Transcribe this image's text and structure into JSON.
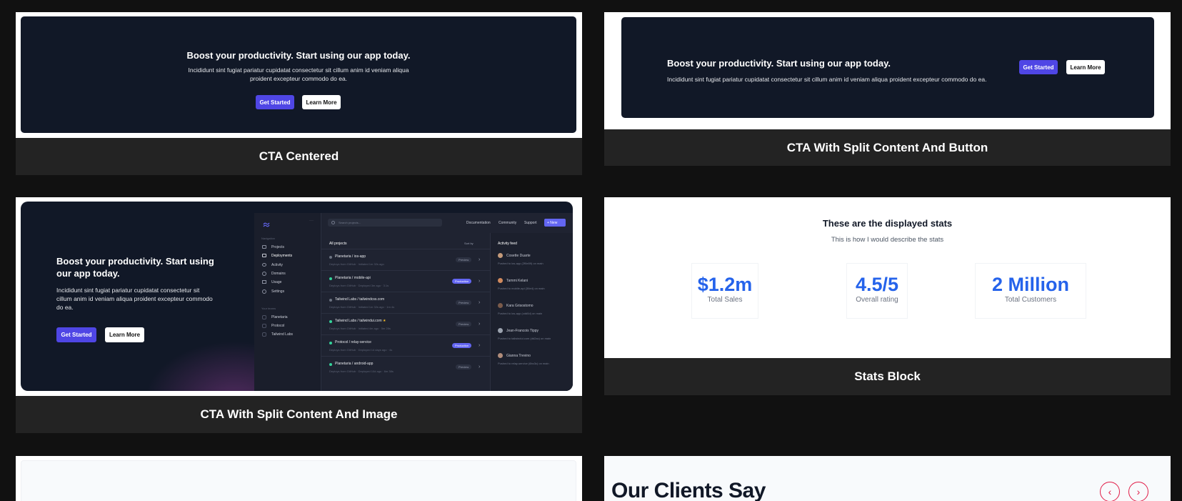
{
  "cta_centered": {
    "title": "Boost your productivity. Start using our app today.",
    "body_line1": "Incididunt sint fugiat pariatur cupidatat consectetur sit cillum anim id veniam aliqua",
    "body_line2": "proident excepteur commodo do ea.",
    "primary": "Get Started",
    "secondary": "Learn More",
    "label": "CTA Centered"
  },
  "cta_split_button": {
    "title": "Boost your productivity. Start using our app today.",
    "body": "Incididunt sint fugiat pariatur cupidatat consectetur sit cillum anim id veniam aliqua proident excepteur commodo do ea.",
    "primary": "Get Started",
    "secondary": "Learn More",
    "label": "CTA With Split Content And Button"
  },
  "cta_split_image": {
    "title_line1": "Boost your productivity. Start using",
    "title_line2": "our app today.",
    "body_line1": "Incididunt sint fugiat pariatur cupidatat consectetur sit",
    "body_line2": "cillum anim id veniam aliqua proident excepteur commodo",
    "body_line3": "do ea.",
    "primary": "Get Started",
    "secondary": "Learn More",
    "label": "CTA With Split Content And Image",
    "mock": {
      "search_placeholder": "Search projects...",
      "top_links": [
        "Documentation",
        "Community",
        "Support"
      ],
      "new_button": "+ New",
      "nav_heading": "Navigation",
      "nav": [
        "Projects",
        "Deployments",
        "Activity",
        "Domains",
        "Usage",
        "Settings"
      ],
      "teams_heading": "Your teams",
      "teams": [
        "Planetaria",
        "Protocol",
        "Tailwind Labs"
      ],
      "list_heading": "All projects",
      "sort": "Sort by",
      "projects": [
        {
          "org": "Planetaria",
          "name": "ios-app",
          "sub": "Deploys from GitHub · Initiated 1m 32s ago",
          "status": "Preview"
        },
        {
          "org": "Planetaria",
          "name": "mobile-api",
          "sub": "Deploys from GitHub · Deployed 3m ago · 3.1s",
          "status": "Production"
        },
        {
          "org": "Tailwind Labs",
          "name": "tailwindcss.com",
          "sub": "Deploys from GitHub · Initiated 1m 32s ago · 1m 4s",
          "status": "Preview"
        },
        {
          "org": "Tailwind Labs",
          "name": "tailwindui.com",
          "sub": "Deploys from GitHub · Initiated 4m ago · 5m 28s",
          "status": "Preview"
        },
        {
          "org": "Protocol",
          "name": "relay-service",
          "sub": "Deploys from GitHub · Deployed 14 days ago · 4s",
          "status": "Production"
        },
        {
          "org": "Planetaria",
          "name": "android-app",
          "sub": "Deploys from GitHub · Deployed 10d ago · 6m 38s",
          "status": "Preview"
        }
      ],
      "feed_heading": "Activity feed",
      "feed": [
        {
          "name": "Cosette Duarte",
          "sub": "Pushed to ios-app (2f0e89) on main"
        },
        {
          "name": "Tammi Kelani",
          "sub": "Pushed to mobile-api (36e4) on main"
        },
        {
          "name": "Kara Grisostomo",
          "sub": "Pushed to ios-app (cdd0d) on main"
        },
        {
          "name": "Jean-Francois Tippy",
          "sub": "Pushed to tailwindui.com (dd2ac) on main"
        },
        {
          "name": "Gianna Trevino",
          "sub": "Pushed to relay-service (6bc3c) on main"
        }
      ]
    }
  },
  "stats_block": {
    "title": "These are the displayed stats",
    "subtitle": "This is how I would describe the stats",
    "stats": [
      {
        "value": "$1.2m",
        "label": "Total Sales"
      },
      {
        "value": "4.5/5",
        "label": "Overall rating"
      },
      {
        "value": "2 Million",
        "label": "Total Customers"
      }
    ],
    "label": "Stats Block"
  },
  "testimonials": {
    "title": "Our Clients Say",
    "prev_icon": "chevron-left-icon",
    "next_icon": "chevron-right-icon"
  }
}
